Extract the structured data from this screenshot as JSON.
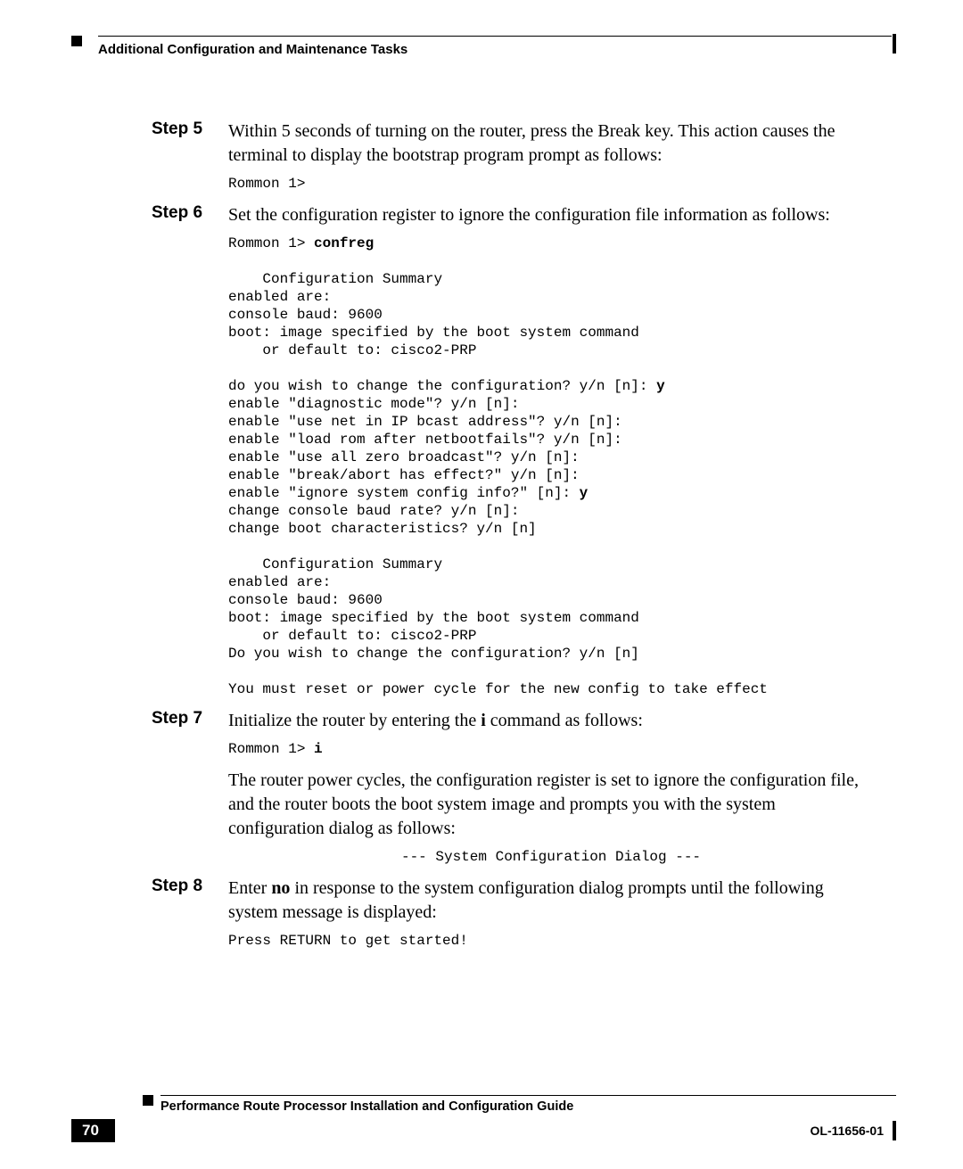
{
  "header": {
    "section_title": "Additional Configuration and Maintenance Tasks"
  },
  "steps": {
    "s5": {
      "label": "Step 5",
      "text": "Within 5 seconds of turning on the router, press the Break key. This action causes the terminal to display the bootstrap program prompt as follows:",
      "code": "Rommon 1>"
    },
    "s6": {
      "label": "Step 6",
      "text": "Set the configuration register to ignore the configuration file information as follows:",
      "code_prompt": "Rommon 1> ",
      "code_cmd": "confreg",
      "code_block1": "    Configuration Summary\nenabled are:\nconsole baud: 9600\nboot: image specified by the boot system command\n    or default to: cisco2-PRP",
      "code_q1_pre": "do you wish to change the configuration? y/n [n]: ",
      "code_q1_ans": "y",
      "code_block2": "enable \"diagnostic mode\"? y/n [n]:\nenable \"use net in IP bcast address\"? y/n [n]:\nenable \"load rom after netbootfails\"? y/n [n]:\nenable \"use all zero broadcast\"? y/n [n]:\nenable \"break/abort has effect?\" y/n [n]:",
      "code_q2_pre": "enable \"ignore system config info?\" [n]: ",
      "code_q2_ans": "y",
      "code_block3": "change console baud rate? y/n [n]:\nchange boot characteristics? y/n [n]\n\n    Configuration Summary\nenabled are:\nconsole baud: 9600\nboot: image specified by the boot system command\n    or default to: cisco2-PRP\nDo you wish to change the configuration? y/n [n]\n\nYou must reset or power cycle for the new config to take effect"
    },
    "s7": {
      "label": "Step 7",
      "text_pre": "Initialize the router by entering the ",
      "text_bold": "i",
      "text_post": " command as follows:",
      "code_prompt": "Rommon 1> ",
      "code_cmd": "i",
      "para2": "The router power cycles, the configuration register is set to ignore the configuration file, and the router boots the boot system image and prompts you with the system configuration dialog as follows:",
      "code2": "--- System Configuration Dialog ---"
    },
    "s8": {
      "label": "Step 8",
      "text_pre": "Enter ",
      "text_bold": "no",
      "text_post": " in response to the system configuration dialog prompts until the following system message is displayed:",
      "code": "Press RETURN to get started!"
    }
  },
  "footer": {
    "guide_title": "Performance Route Processor Installation and Configuration Guide",
    "page_number": "70",
    "doc_id": "OL-11656-01"
  }
}
